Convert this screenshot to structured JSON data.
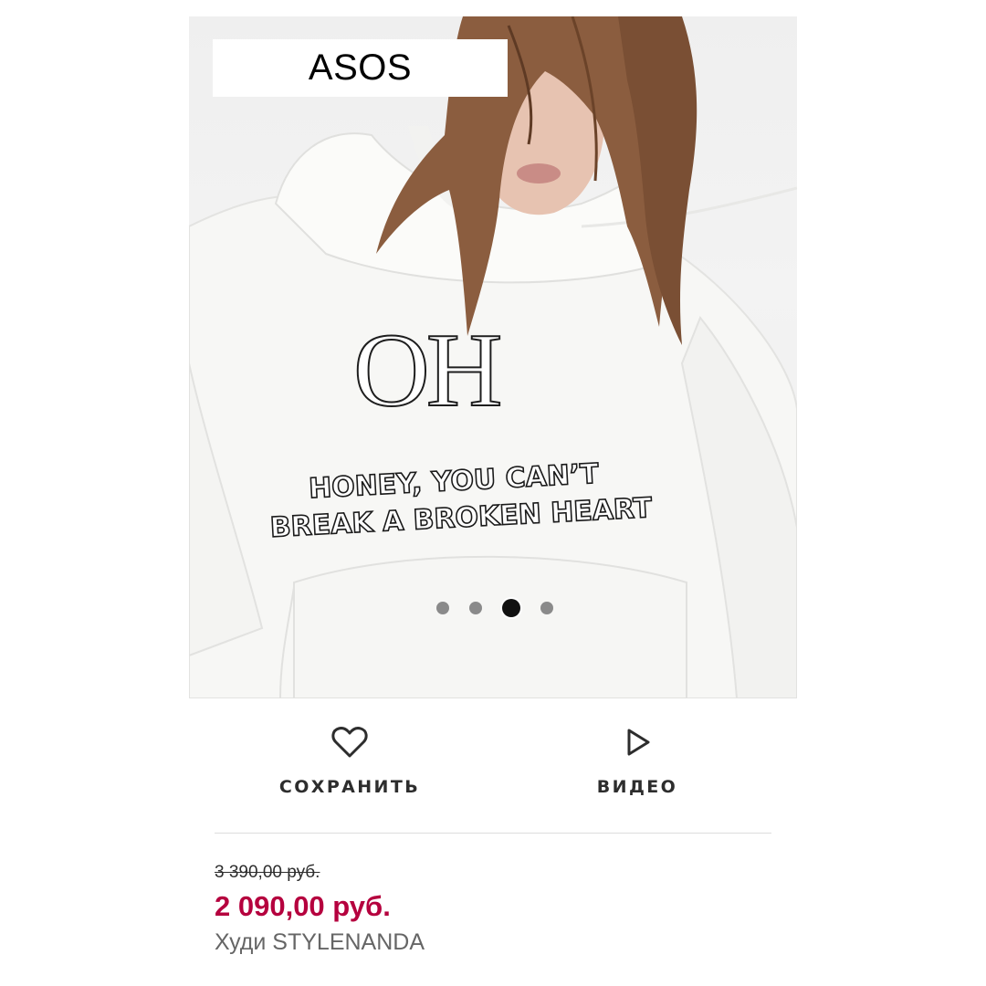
{
  "brand": {
    "name": "ASOS"
  },
  "product_image": {
    "print_title": "OH",
    "print_line_1": "HONEY, YOU CAN’T",
    "print_line_2": "BREAK A BROKEN HEART",
    "carousel": {
      "total": 4,
      "active_index": 3
    }
  },
  "actions": {
    "save_label": "СОХРАНИТЬ",
    "save_icon": "heart-icon",
    "video_label": "ВИДЕО",
    "video_icon": "play-icon"
  },
  "pricing": {
    "old_price": "3 390,00 руб.",
    "new_price": "2 090,00 руб."
  },
  "product": {
    "name": "Худи STYLENANDA"
  },
  "colors": {
    "sale": "#b5003e",
    "text": "#2d2d2d",
    "muted": "#666666"
  }
}
